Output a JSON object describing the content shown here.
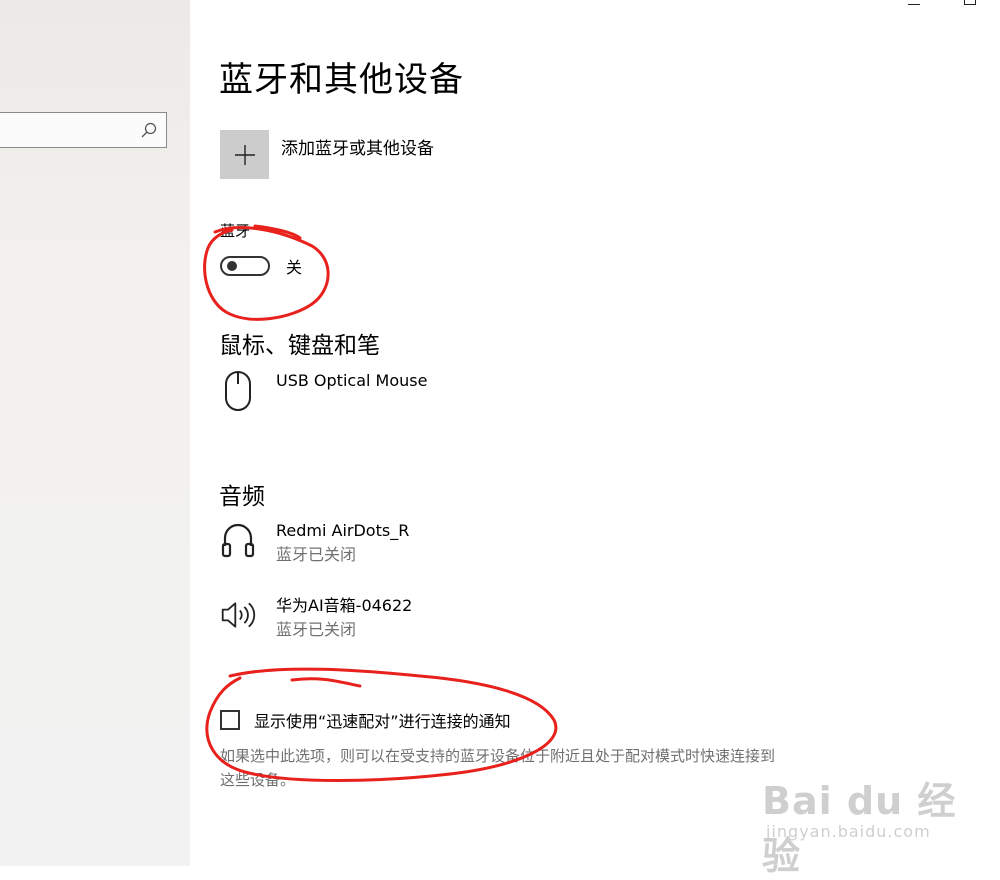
{
  "window": {
    "minimize_label": "–",
    "maximize_label": "□"
  },
  "sidebar": {
    "search": {
      "placeholder": ""
    }
  },
  "page": {
    "title": "蓝牙和其他设备"
  },
  "add_device": {
    "icon": "plus-icon",
    "label": "添加蓝牙或其他设备"
  },
  "bluetooth": {
    "label": "蓝牙",
    "toggle_state": "关",
    "is_on": false
  },
  "mouse_section": {
    "title": "鼠标、键盘和笔",
    "devices": [
      {
        "name": "USB Optical Mouse",
        "icon": "mouse-icon"
      }
    ]
  },
  "audio_section": {
    "title": "音频",
    "devices": [
      {
        "name": "Redmi AirDots_R",
        "status": "蓝牙已关闭",
        "icon": "headphones-icon"
      },
      {
        "name": "华为AI音箱-04622",
        "status": "蓝牙已关闭",
        "icon": "speaker-icon"
      }
    ]
  },
  "swift_pair": {
    "label": "显示使用“迅速配对”进行连接的通知",
    "checked": false,
    "description": "如果选中此选项，则可以在受支持的蓝牙设备位于附近且处于配对模式时快速连接到这些设备。"
  },
  "watermark": {
    "main": "Bai du 经验",
    "sub": "jingyan.baidu.com"
  },
  "colors": {
    "annotation": "#e8211c",
    "tile": "#cccccc",
    "status": "#707070"
  }
}
